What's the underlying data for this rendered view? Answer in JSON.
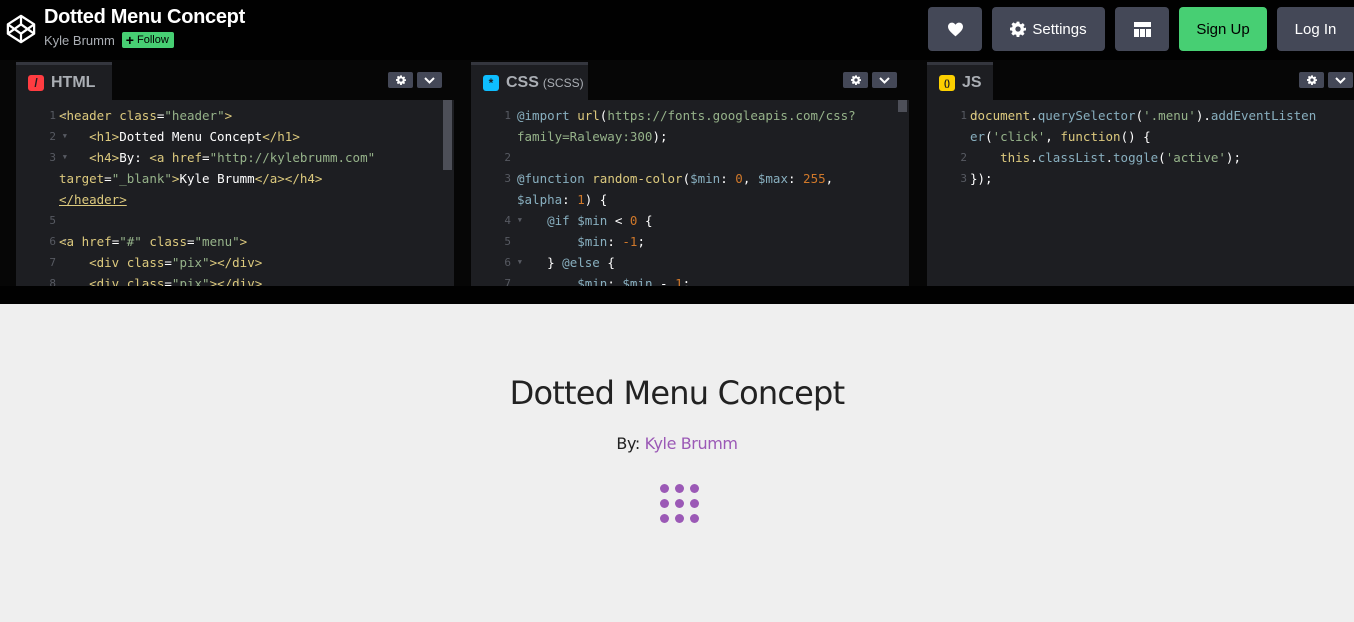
{
  "pen": {
    "title": "Dotted Menu Concept",
    "author": "Kyle Brumm",
    "follow_label": "Follow"
  },
  "toolbar": {
    "heart_icon": "heart-icon",
    "settings_label": "Settings",
    "layout_icon": "layout-icon",
    "signup_label": "Sign Up",
    "login_label": "Log In"
  },
  "editors": {
    "html": {
      "label": "HTML",
      "icon_glyph": "/",
      "icon_color": "#ff3c41"
    },
    "css": {
      "label": "CSS",
      "sublabel": "(SCSS)",
      "icon_glyph": "*",
      "icon_color": "#0ebeff"
    },
    "js": {
      "label": "JS",
      "icon_glyph": "()",
      "icon_color": "#fcd000"
    }
  },
  "html_code": [
    {
      "num": "1",
      "fold": true,
      "html": "<span class=\"tg\">&lt;header</span> <span class=\"at\">class</span><span class=\"pl\">=</span><span class=\"av\">\"header\"</span><span class=\"tg\">&gt;</span>"
    },
    {
      "num": "2",
      "fold": true,
      "html": "    <span class=\"tg\">&lt;h1&gt;</span><span class=\"pl\">Dotted Menu Concept</span><span class=\"tg\">&lt;/h1&gt;</span>"
    },
    {
      "num": "3",
      "fold": true,
      "html": "    <span class=\"tg\">&lt;h4&gt;</span><span class=\"pl\">By: </span><span class=\"tg\">&lt;a</span> <span class=\"at\">href</span><span class=\"pl\">=</span><span class=\"av\">\"http://kylebrumm.com\"</span>"
    },
    {
      "num": "",
      "fold": false,
      "html": "<span class=\"at\">target</span><span class=\"pl\">=</span><span class=\"av\">\"_blank\"</span><span class=\"tg\">&gt;</span><span class=\"pl\">Kyle Brumm</span><span class=\"tg\">&lt;/a&gt;&lt;/h4&gt;</span>"
    },
    {
      "num": "",
      "fold": false,
      "html": "<span class=\"tg u\">&lt;/header&gt;</span>"
    },
    {
      "num": "5",
      "fold": false,
      "html": ""
    },
    {
      "num": "6",
      "fold": true,
      "html": "<span class=\"tg\">&lt;a</span> <span class=\"at\">href</span><span class=\"pl\">=</span><span class=\"av\">\"#\"</span> <span class=\"at\">class</span><span class=\"pl\">=</span><span class=\"av\">\"menu\"</span><span class=\"tg\">&gt;</span>"
    },
    {
      "num": "7",
      "fold": false,
      "html": "    <span class=\"tg\">&lt;div</span> <span class=\"at\">class</span><span class=\"pl\">=</span><span class=\"av\">\"pix\"</span><span class=\"tg\">&gt;&lt;/div&gt;</span>"
    },
    {
      "num": "8",
      "fold": false,
      "html": "    <span class=\"tg\">&lt;div</span> <span class=\"at\">class</span><span class=\"pl\">=</span><span class=\"av\">\"pix\"</span><span class=\"tg\">&gt;&lt;/div&gt;</span>"
    }
  ],
  "css_code": [
    {
      "num": "1",
      "fold": false,
      "html": "<span class=\"kw\">@import</span> <span class=\"fn\">url</span><span class=\"pl\">(</span><span class=\"str\">https://fonts.googleapis.com/css?</span>"
    },
    {
      "num": "",
      "fold": false,
      "html": "<span class=\"str\">family=Raleway:300</span><span class=\"pl\">);</span>"
    },
    {
      "num": "2",
      "fold": false,
      "html": ""
    },
    {
      "num": "3",
      "fold": true,
      "html": "<span class=\"kw\">@function</span> <span class=\"fn\">random-color</span><span class=\"pl\">(</span><span class=\"vr\">$min</span><span class=\"pl\">: </span><span class=\"num\">0</span><span class=\"pl\">, </span><span class=\"vr\">$max</span><span class=\"pl\">: </span><span class=\"num\">255</span><span class=\"pl\">,</span>"
    },
    {
      "num": "",
      "fold": false,
      "html": "<span class=\"vr\">$alpha</span><span class=\"pl\">: </span><span class=\"num\">1</span><span class=\"pl\">) {</span>"
    },
    {
      "num": "4",
      "fold": true,
      "html": "    <span class=\"kw\">@if</span> <span class=\"vr\">$min</span> <span class=\"pl\">&lt; </span><span class=\"num\">0</span> <span class=\"pl\">{</span>"
    },
    {
      "num": "5",
      "fold": false,
      "html": "        <span class=\"vr\">$min</span><span class=\"pl\">: </span><span class=\"num\">-1</span><span class=\"pl\">;</span>"
    },
    {
      "num": "6",
      "fold": true,
      "html": "    <span class=\"pl\">} </span><span class=\"kw\">@else</span> <span class=\"pl\">{</span>"
    },
    {
      "num": "7",
      "fold": false,
      "html": "        <span class=\"vr\">$min</span><span class=\"pl\">: </span><span class=\"vr\">$min</span> <span class=\"pl\">- </span><span class=\"num\">1</span><span class=\"pl\">;</span>"
    }
  ],
  "js_code": [
    {
      "num": "1",
      "fold": true,
      "html": "<span class=\"fn\">document</span><span class=\"pl\">.</span><span class=\"kw\">querySelector</span><span class=\"pl\">(</span><span class=\"str\">'.menu'</span><span class=\"pl\">).</span><span class=\"kw\">addEventListen</span>"
    },
    {
      "num": "",
      "fold": false,
      "html": "<span class=\"kw\">er</span><span class=\"pl\">(</span><span class=\"str\">'click'</span><span class=\"pl\">, </span><span class=\"fn\">function</span><span class=\"pl\">() {</span>"
    },
    {
      "num": "2",
      "fold": false,
      "html": "    <span class=\"fn\">this</span><span class=\"pl\">.</span><span class=\"kw\">classList</span><span class=\"pl\">.</span><span class=\"kw\">toggle</span><span class=\"pl\">(</span><span class=\"str\">'active'</span><span class=\"pl\">);</span>"
    },
    {
      "num": "3",
      "fold": false,
      "html": "<span class=\"pl\">});</span>"
    }
  ],
  "preview": {
    "title": "Dotted Menu Concept",
    "by_label": "By: ",
    "author_link": "Kyle Brumm",
    "accent_color": "#9b59b6",
    "menu_dot_count": 9
  }
}
